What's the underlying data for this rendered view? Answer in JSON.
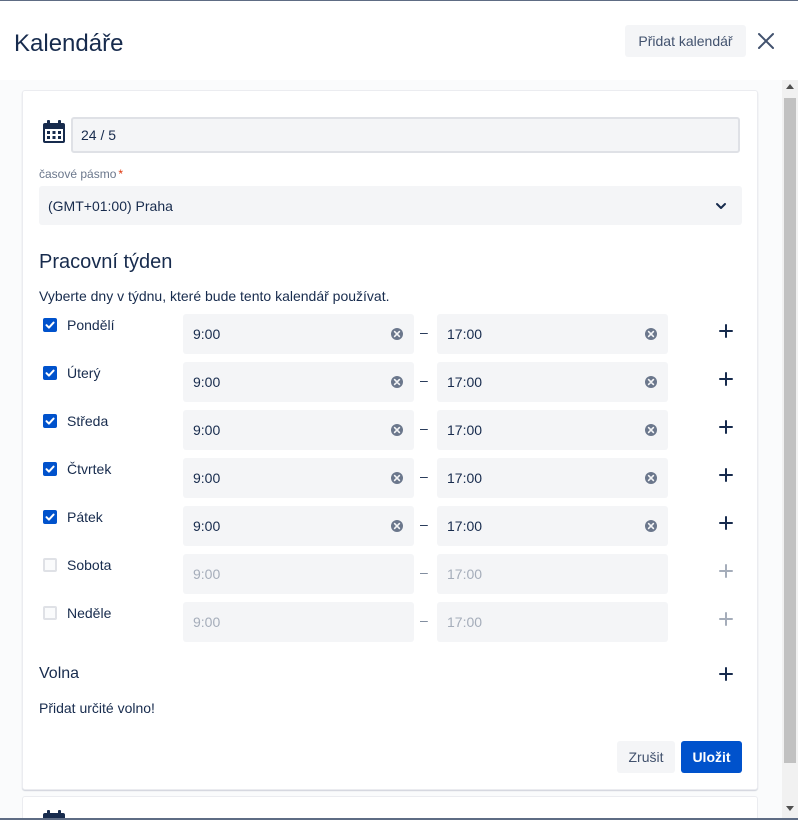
{
  "header": {
    "title": "Kalendáře",
    "add_calendar_label": "Přidat kalendář",
    "close_icon": "close-icon"
  },
  "calendar": {
    "icon": "calendar-icon",
    "name_value": "24 / 5",
    "timezone_label": "časové pásmo",
    "timezone_required_mark": "*",
    "timezone_value": "(GMT+01:00) Praha"
  },
  "working_week": {
    "heading": "Pracovní týden",
    "description": "Vyberte dny v týdnu, které bude tento kalendář používat.",
    "separator": "–",
    "days": [
      {
        "label": "Pondělí",
        "checked": true,
        "start": "9:00",
        "end": "17:00"
      },
      {
        "label": "Úterý",
        "checked": true,
        "start": "9:00",
        "end": "17:00"
      },
      {
        "label": "Středa",
        "checked": true,
        "start": "9:00",
        "end": "17:00"
      },
      {
        "label": "Čtvrtek",
        "checked": true,
        "start": "9:00",
        "end": "17:00"
      },
      {
        "label": "Pátek",
        "checked": true,
        "start": "9:00",
        "end": "17:00"
      },
      {
        "label": "Sobota",
        "checked": false,
        "start": "9:00",
        "end": "17:00"
      },
      {
        "label": "Neděle",
        "checked": false,
        "start": "9:00",
        "end": "17:00"
      }
    ]
  },
  "holidays": {
    "heading": "Volna",
    "text": "Přidat určité volno!"
  },
  "actions": {
    "cancel_label": "Zrušit",
    "save_label": "Uložit"
  },
  "colors": {
    "primary": "#0052cc",
    "text": "#172b4d",
    "field_bg": "#f4f5f7",
    "disabled_text": "#a5adba",
    "required": "#de350b"
  }
}
